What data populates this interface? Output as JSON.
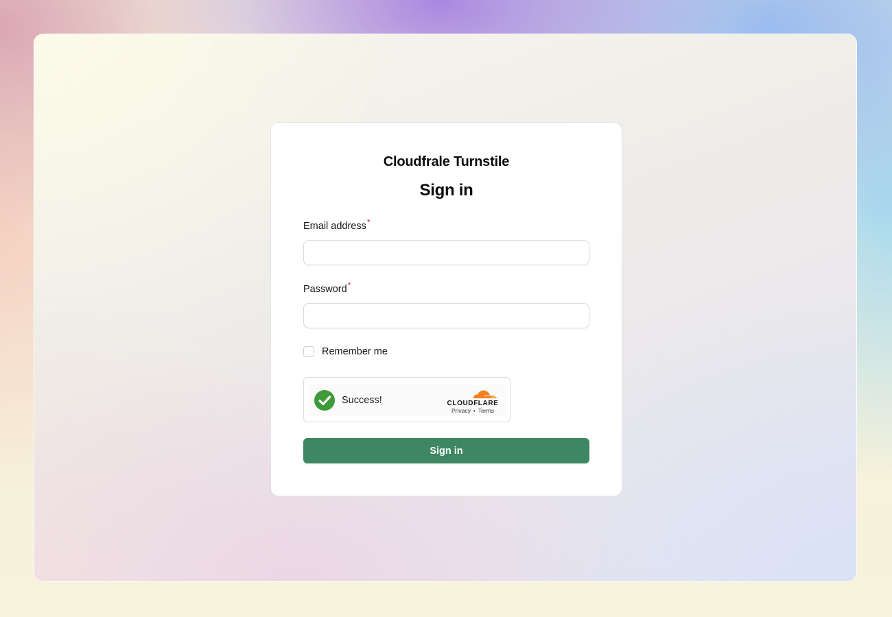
{
  "app": {
    "brand": "Cloudfrale Turnstile",
    "heading": "Sign in"
  },
  "form": {
    "email": {
      "label": "Email address",
      "required_marker": "*",
      "value": ""
    },
    "password": {
      "label": "Password",
      "required_marker": "*",
      "value": ""
    },
    "remember": {
      "label": "Remember me",
      "checked": false
    },
    "submit_label": "Sign in"
  },
  "turnstile": {
    "status_text": "Success!",
    "status_icon": "check-circle-icon",
    "logo_text": "CLOUDFLARE",
    "privacy_link": "Privacy",
    "separator": "•",
    "terms_link": "Terms"
  },
  "colors": {
    "primary_button": "#3d8862",
    "success_green": "#3f9a3a",
    "cloudflare_orange": "#f38020",
    "required_red": "#dc2626"
  }
}
